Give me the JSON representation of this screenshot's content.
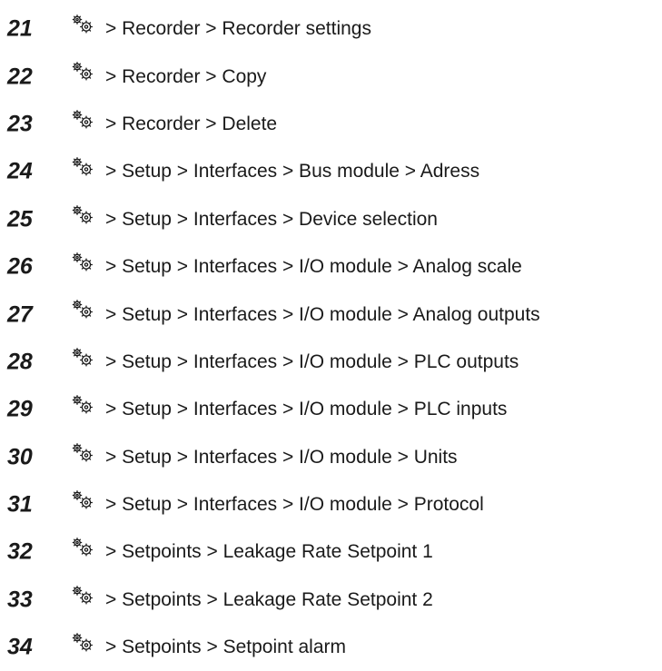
{
  "icons": {
    "settings": "gears-icon"
  },
  "menu_entries": [
    {
      "number": "21",
      "path": "> Recorder > Recorder settings"
    },
    {
      "number": "22",
      "path": "> Recorder > Copy"
    },
    {
      "number": "23",
      "path": "> Recorder > Delete"
    },
    {
      "number": "24",
      "path": "> Setup > Interfaces > Bus module > Adress"
    },
    {
      "number": "25",
      "path": "> Setup > Interfaces > Device selection"
    },
    {
      "number": "26",
      "path": "> Setup > Interfaces > I/O module > Analog scale"
    },
    {
      "number": "27",
      "path": "> Setup > Interfaces > I/O module > Analog outputs"
    },
    {
      "number": "28",
      "path": "> Setup > Interfaces > I/O module > PLC outputs"
    },
    {
      "number": "29",
      "path": "> Setup > Interfaces > I/O module > PLC inputs"
    },
    {
      "number": "30",
      "path": "> Setup > Interfaces > I/O module > Units"
    },
    {
      "number": "31",
      "path": "> Setup > Interfaces > I/O module > Protocol"
    },
    {
      "number": "32",
      "path": "> Setpoints > Leakage Rate Setpoint 1"
    },
    {
      "number": "33",
      "path": "> Setpoints > Leakage Rate Setpoint 2"
    },
    {
      "number": "34",
      "path": "> Setpoints > Setpoint alarm"
    }
  ]
}
